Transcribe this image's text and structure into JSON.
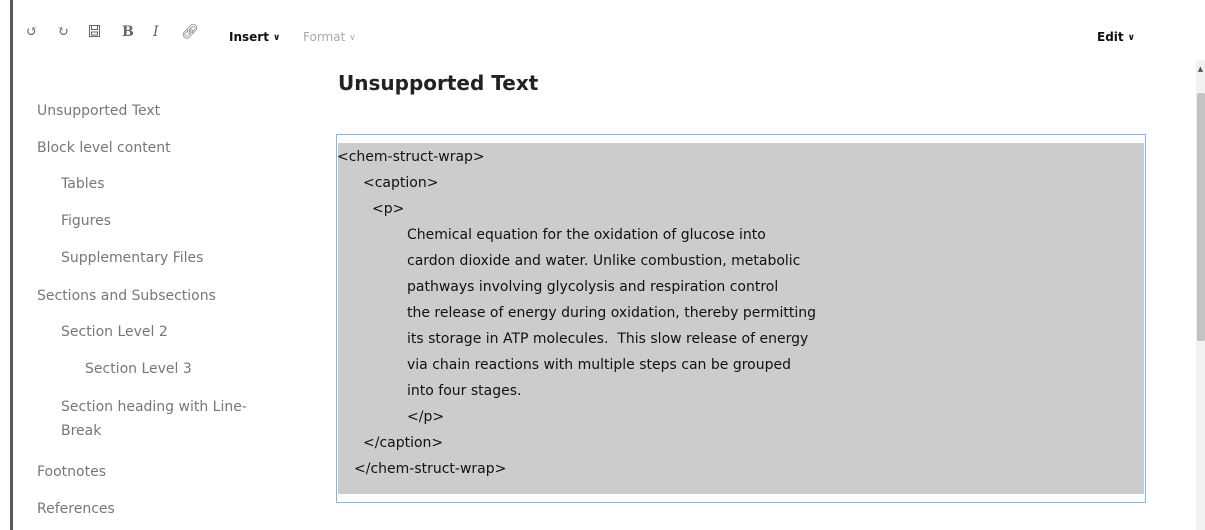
{
  "toolbar": {
    "insert_label": "Insert",
    "format_label": "Format",
    "edit_label": "Edit",
    "icons": [
      "undo-icon",
      "redo-icon",
      "save-icon",
      "bold-icon",
      "italic-icon",
      "link-icon"
    ]
  },
  "sidebar": {
    "items": [
      {
        "label": "Unsupported Text",
        "level": 1
      },
      {
        "label": "Block level content",
        "level": 1
      },
      {
        "label": "Tables",
        "level": 2
      },
      {
        "label": "Figures",
        "level": 2
      },
      {
        "label": "Supplementary Files",
        "level": 2
      },
      {
        "label": "Sections and Subsections",
        "level": 1
      },
      {
        "label": "Section Level 2",
        "level": 2
      },
      {
        "label": "Section Level 3",
        "level": 3
      },
      {
        "label": "Section heading with Line-Break",
        "level": 2
      },
      {
        "label": "Footnotes",
        "level": 1
      },
      {
        "label": "References",
        "level": 1
      }
    ]
  },
  "main": {
    "title": "Unsupported Text",
    "code_lines": [
      "<chem-struct-wrap>",
      "<caption>",
      "<p>",
      "Chemical equation for the oxidation of glucose into",
      "cardon dioxide and water. Unlike combustion, metabolic",
      "pathways involving glycolysis and respiration control",
      "the release of energy during oxidation, thereby permitting",
      "its storage in ATP molecules.  This slow release of energy",
      "via chain reactions with multiple steps can be grouped",
      "into four stages.",
      "</p>",
      "</caption>",
      "</chem-struct-wrap>"
    ]
  },
  "colors": {
    "code_background": "#cccccc",
    "code_border": "#8ab4e0",
    "format_disabled": "#aaaaaa"
  }
}
